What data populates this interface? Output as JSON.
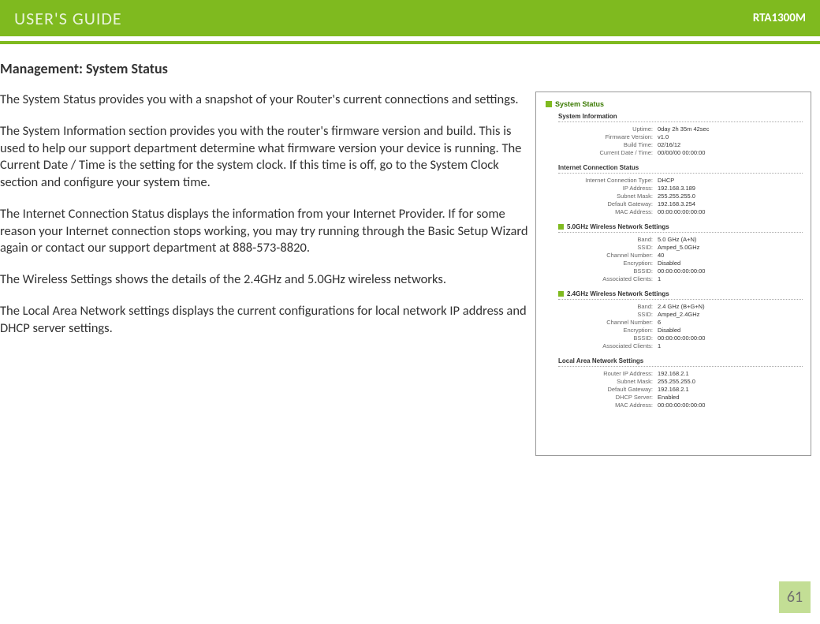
{
  "header": {
    "title": "USER'S GUIDE",
    "model": "RTA1300M"
  },
  "page_number": "61",
  "heading": "Management: System Status",
  "paragraphs": [
    "The System Status provides you with a snapshot of your Router's current connections and settings.",
    "The System Information section provides you with the router's firmware version and build.  This is used to help our support department determine what firmware version your device is running.  The Current Date / Time is the setting for the system clock.  If this time is off, go to the System Clock section and configure your system time.",
    "The Internet Connection Status displays the information from your Internet Provider.  If for some reason your Internet connection stops working, you may try running through the Basic Setup Wizard again or contact our support department at 888-573-8820.",
    "The Wireless Settings shows the details of the 2.4GHz and 5.0GHz wireless networks.",
    "The Local Area Network settings displays the current configurations for local network IP address and DHCP server settings."
  ],
  "screenshot": {
    "title": "System Status",
    "sections": [
      {
        "name": "System Information",
        "rows": [
          {
            "k": "Uptime:",
            "v": "0day 2h 35m 42sec"
          },
          {
            "k": "Firmware Version:",
            "v": "v1.0"
          },
          {
            "k": "Build Time:",
            "v": "02/16/12"
          },
          {
            "k": "Current Date / Time:",
            "v": "00/00/00 00:00:00"
          }
        ]
      },
      {
        "name": "Internet Connection Status",
        "rows": [
          {
            "k": "Internet Connection Type:",
            "v": "DHCP"
          },
          {
            "k": "IP Address:",
            "v": "192.168.3.189"
          },
          {
            "k": "Subnet Mask:",
            "v": "255.255.255.0"
          },
          {
            "k": "Default Gateway:",
            "v": "192.168.3.254"
          },
          {
            "k": "MAC Address:",
            "v": "00:00:00:00:00:00"
          }
        ]
      },
      {
        "name": "5.0GHz Wireless Network Settings",
        "rows": [
          {
            "k": "Band:",
            "v": "5.0 GHz (A+N)"
          },
          {
            "k": "SSID:",
            "v": "Amped_5.0GHz"
          },
          {
            "k": "Channel Number:",
            "v": "40"
          },
          {
            "k": "Encryption:",
            "v": "Disabled"
          },
          {
            "k": "BSSID:",
            "v": "00:00:00:00:00:00"
          },
          {
            "k": "Associated Clients:",
            "v": "1"
          }
        ]
      },
      {
        "name": "2.4GHz Wireless Network Settings",
        "rows": [
          {
            "k": "Band:",
            "v": "2.4 GHz (B+G+N)"
          },
          {
            "k": "SSID:",
            "v": "Amped_2.4GHz"
          },
          {
            "k": "Channel Number:",
            "v": "6"
          },
          {
            "k": "Encryption:",
            "v": "Disabled"
          },
          {
            "k": "BSSID:",
            "v": "00:00:00:00:00:00"
          },
          {
            "k": "Associated Clients:",
            "v": "1"
          }
        ]
      },
      {
        "name": "Local Area Network Settings",
        "rows": [
          {
            "k": "Router IP Address:",
            "v": "192.168.2.1"
          },
          {
            "k": "Subnet Mask:",
            "v": "255.255.255.0"
          },
          {
            "k": "Default Gateway:",
            "v": "192.168.2.1"
          },
          {
            "k": "DHCP Server:",
            "v": "Enabled"
          },
          {
            "k": "MAC Address:",
            "v": "00:00:00:00:00:00"
          }
        ]
      }
    ]
  }
}
